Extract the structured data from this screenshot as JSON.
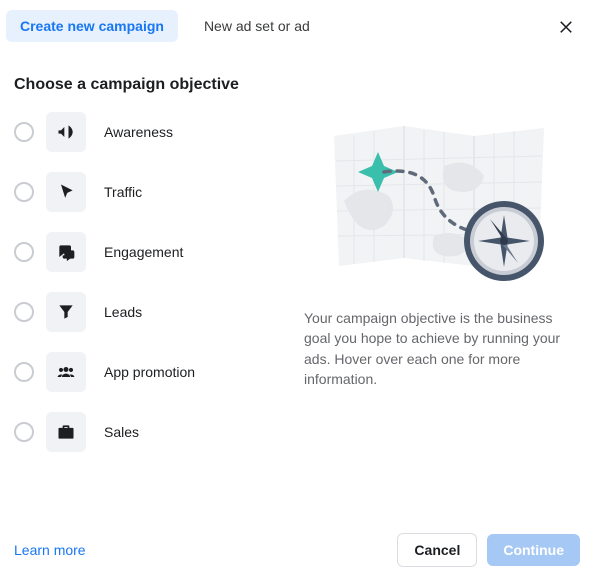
{
  "tabs": {
    "create": "Create new campaign",
    "newadset": "New ad set or ad"
  },
  "heading": "Choose a campaign objective",
  "objectives": {
    "awareness": "Awareness",
    "traffic": "Traffic",
    "engagement": "Engagement",
    "leads": "Leads",
    "app": "App promotion",
    "sales": "Sales"
  },
  "description": "Your campaign objective is the business goal you hope to achieve by running your ads. Hover over each one for more information.",
  "footer": {
    "learn": "Learn more",
    "cancel": "Cancel",
    "continue": "Continue"
  }
}
